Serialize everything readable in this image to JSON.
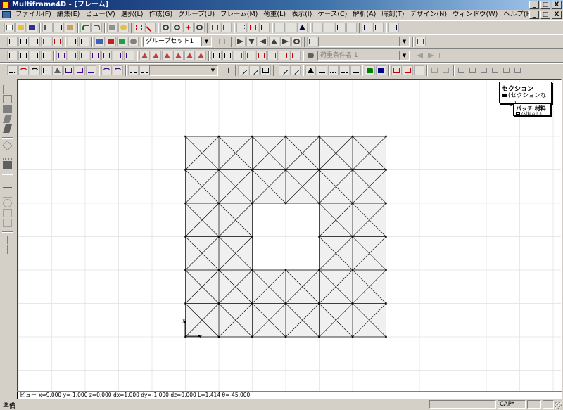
{
  "window": {
    "title": "Multiframe4D - [フレーム]",
    "buttons": [
      "_",
      "□",
      "X"
    ],
    "mdi_buttons": [
      "_",
      "□",
      "X"
    ]
  },
  "menu": [
    "ファイル(F)",
    "編集(E)",
    "ビュー(V)",
    "選択(L)",
    "作成(G)",
    "グループ(U)",
    "フレーム(M)",
    "荷重(L)",
    "表示(I)",
    "ケース(C)",
    "解析(A)",
    "時刻(T)",
    "デザイン(N)",
    "ウィンドウ(W)",
    "ヘルプ(H)"
  ],
  "toolbar": {
    "group_set": "グループセット1",
    "load_case_name": "荷重条件名 1"
  },
  "legend": {
    "section_title": "セクション",
    "section_item": "(セクションなし)",
    "patch_title": "パッチ 材料",
    "patch_item": "(材料なし)"
  },
  "axes": {
    "x": "x",
    "y": "y"
  },
  "view_tab": "ビュー",
  "coords": "x=9.000 y=-1.000 z=0.000 dx=1.000 dy=-1.000 dz=0.000 L=1.414 θ=-45.000",
  "status": {
    "message": "準備",
    "cap": "CAP*"
  },
  "colors": {
    "titlebar": "#0a246a",
    "chrome": "#d4d0c8",
    "panel_fill": "#f0f0f0",
    "grid": "#e0e0e0"
  },
  "structure": {
    "columns": 6,
    "rows": 6,
    "hole": {
      "col_from": 2,
      "col_to": 3,
      "row_from": 2,
      "row_to": 3
    }
  }
}
